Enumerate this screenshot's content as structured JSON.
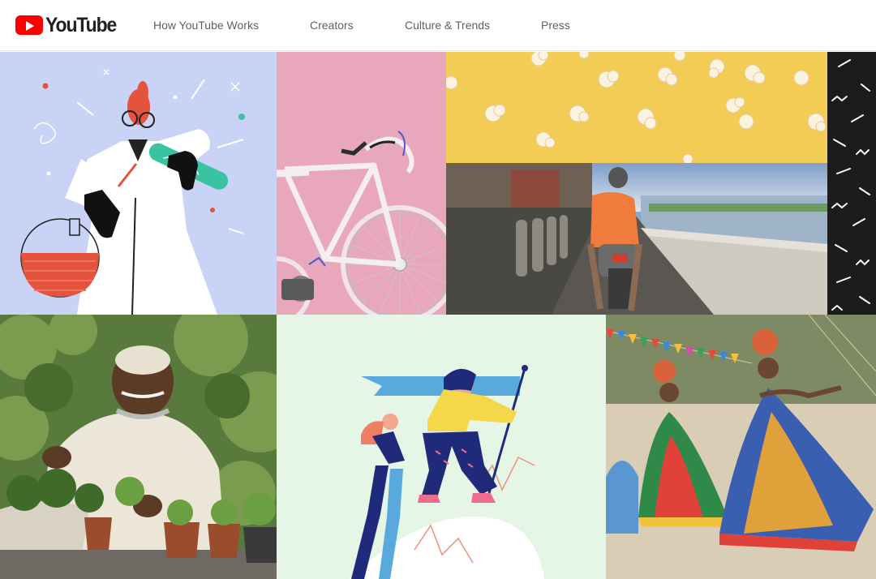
{
  "header": {
    "logo_text": "YouTube",
    "nav": [
      "How YouTube Works",
      "Creators",
      "Culture & Trends",
      "Press"
    ]
  },
  "colors": {
    "brand_red": "#ff0000",
    "tile_lavender": "#c8d3f5",
    "tile_pink": "#e9a7bc",
    "tile_yellow": "#f3cc55",
    "tile_mint": "#e5f6e7",
    "tile_black": "#1c1c1c"
  },
  "tiles": [
    {
      "name": "scientist-illustration",
      "icon": "scientist-illustration"
    },
    {
      "name": "bicycle-photo",
      "icon": "bicycle-photo"
    },
    {
      "name": "popcorn-photo",
      "icon": "popcorn-photo"
    },
    {
      "name": "pattern-strip",
      "icon": "zigzag-pattern"
    },
    {
      "name": "scooter-riverside-photo",
      "icon": "scooter-photo"
    },
    {
      "name": "gardener-photo",
      "icon": "gardener-photo"
    },
    {
      "name": "climbers-illustration",
      "icon": "climbers-illustration"
    },
    {
      "name": "dancers-photo",
      "icon": "dancers-photo"
    }
  ]
}
